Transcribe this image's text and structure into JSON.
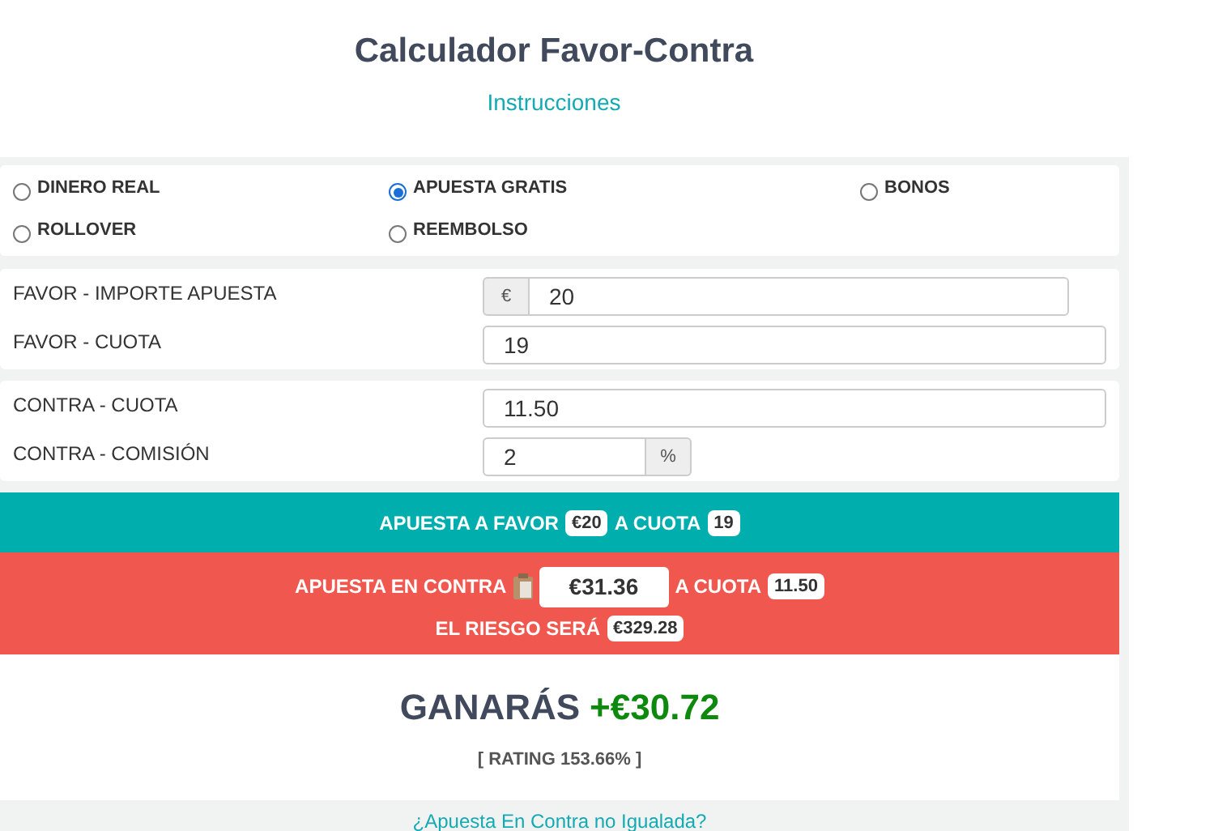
{
  "title": "Calculador Favor-Contra",
  "instructions_link": "Instrucciones",
  "bet_types": [
    {
      "label": "DINERO REAL",
      "selected": false
    },
    {
      "label": "APUESTA GRATIS",
      "selected": true
    },
    {
      "label": "BONOS",
      "selected": false
    },
    {
      "label": "ROLLOVER",
      "selected": false
    },
    {
      "label": "REEMBOLSO",
      "selected": false
    }
  ],
  "field_groups": [
    [
      {
        "label": "FAVOR - IMPORTE APUESTA",
        "value": "20",
        "prefix": "€"
      },
      {
        "label": "FAVOR - CUOTA",
        "value": "19"
      }
    ],
    [
      {
        "label": "CONTRA - CUOTA",
        "value": "11.50"
      },
      {
        "label": "CONTRA - COMISIÓN",
        "value": "2",
        "suffix": "%"
      }
    ]
  ],
  "favor_summary": {
    "label": "APUESTA A FAVOR",
    "stake": "€20",
    "odds_label": "A CUOTA",
    "odds": "19"
  },
  "contra_summary": {
    "label": "APUESTA EN CONTRA",
    "stake": "€31.36",
    "odds_label": "A CUOTA",
    "odds": "11.50",
    "risk_label": "EL RIESGO SERÁ",
    "risk": "€329.28"
  },
  "result": {
    "label": "GANARÁS",
    "value": "+€30.72",
    "rating": "[ RATING 153.66% ]"
  },
  "footer_link": "¿Apuesta En Contra no Igualada?"
}
